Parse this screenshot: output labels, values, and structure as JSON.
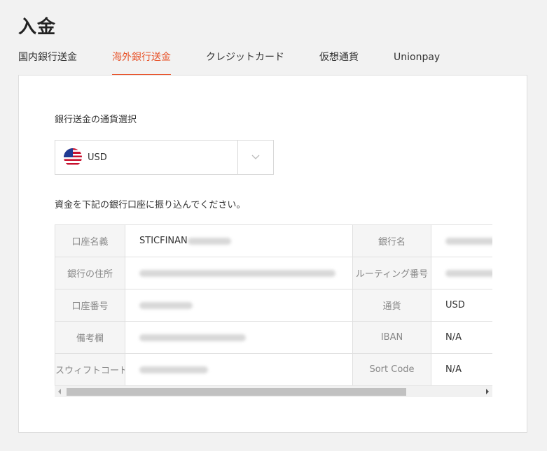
{
  "page": {
    "title": "入金"
  },
  "tabs": [
    {
      "label": "国内銀行送金",
      "active": false
    },
    {
      "label": "海外銀行送金",
      "active": true
    },
    {
      "label": "クレジットカード",
      "active": false
    },
    {
      "label": "仮想通貨",
      "active": false
    },
    {
      "label": "Unionpay",
      "active": false
    }
  ],
  "colors": {
    "accent": "#e8542b",
    "label_bg": "#f5f5f5",
    "border": "#e0e0e0"
  },
  "currency": {
    "label": "銀行送金の通貨選択",
    "selected": "USD",
    "flag_icon": "us-flag-icon",
    "dropdown_icon": "chevron-down-icon"
  },
  "instruction": "資金を下記の銀行口座に振り込んでください。",
  "bank_table": {
    "rows": [
      {
        "label1": "口座名義",
        "value1": "STICFINAN",
        "label2": "銀行名",
        "value2": ""
      },
      {
        "label1": "銀行の住所",
        "value1": "",
        "label2": "ルーティング番号",
        "value2": ""
      },
      {
        "label1": "口座番号",
        "value1": "",
        "label2": "通貨",
        "value2": "USD"
      },
      {
        "label1": "備考欄",
        "value1": "",
        "label2": "IBAN",
        "value2": "N/A"
      },
      {
        "label1": "スウィフトコード",
        "value1": "",
        "label2": "Sort Code",
        "value2": "N/A"
      }
    ]
  }
}
